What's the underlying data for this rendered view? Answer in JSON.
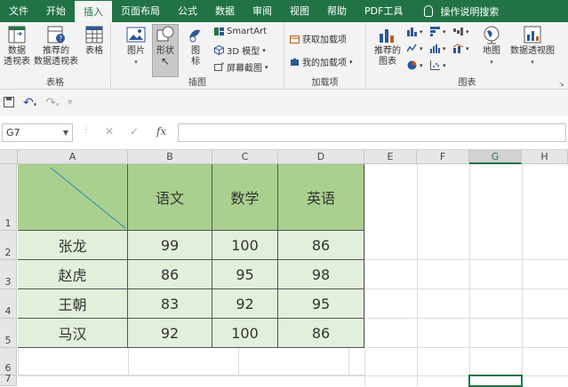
{
  "tabs": [
    "文件",
    "开始",
    "插入",
    "页面布局",
    "公式",
    "数据",
    "审阅",
    "视图",
    "帮助",
    "PDF工具"
  ],
  "active_tab_index": 2,
  "tell_me": "操作说明搜索",
  "ribbon": {
    "table_group": {
      "label": "表格",
      "pivot": "数据\n透视表",
      "recommended_pivot": "推荐的\n数据透视表",
      "table": "表格"
    },
    "illustrations_group": {
      "label": "插图",
      "picture": "图片",
      "shapes": "形状",
      "icons": "图\n标",
      "smartart": "SmartArt",
      "model3d": "3D 模型",
      "screenshot": "屏幕截图"
    },
    "addins_group": {
      "label": "加载项",
      "get_addins": "获取加载项",
      "my_addins": "我的加载项"
    },
    "charts_group": {
      "label": "图表",
      "recommended_charts": "推荐的\n图表",
      "maps": "地图",
      "pivot_chart": "数据透视图"
    }
  },
  "namebox": "G7",
  "columns": [
    "A",
    "B",
    "C",
    "D",
    "E",
    "F",
    "G",
    "H"
  ],
  "selected_column": "G",
  "rows": [
    "1",
    "2",
    "3",
    "4",
    "5",
    "6",
    "7"
  ],
  "table": {
    "headers": [
      "",
      "语文",
      "数学",
      "英语"
    ],
    "data": [
      [
        "张龙",
        "99",
        "100",
        "86"
      ],
      [
        "赵虎",
        "86",
        "95",
        "98"
      ],
      [
        "王朝",
        "83",
        "92",
        "95"
      ],
      [
        "马汉",
        "92",
        "100",
        "86"
      ]
    ]
  },
  "colors": {
    "ribbon_green": "#217346",
    "header_fill": "#a9d08e",
    "body_fill": "#e2efda"
  }
}
